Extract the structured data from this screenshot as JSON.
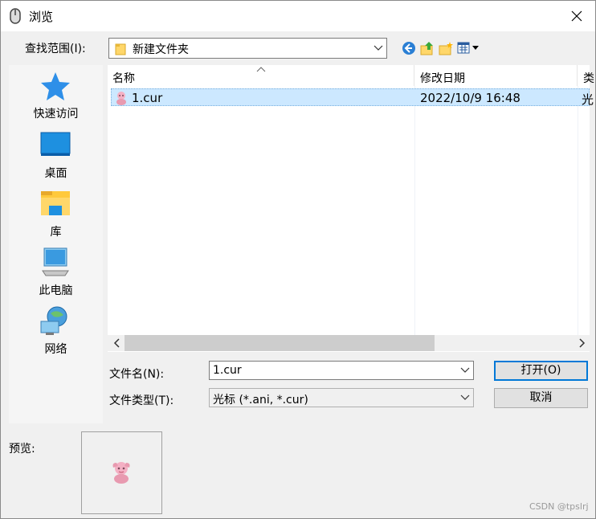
{
  "window": {
    "title": "浏览",
    "close_label": "✕"
  },
  "lookin": {
    "label": "查找范围(I):",
    "value": "新建文件夹"
  },
  "toolbar": {
    "icons": [
      "back-icon",
      "up-folder-icon",
      "new-folder-icon",
      "view-menu-icon"
    ]
  },
  "places": [
    {
      "label": "快速访问",
      "icon": "star-icon"
    },
    {
      "label": "桌面",
      "icon": "desktop-icon"
    },
    {
      "label": "库",
      "icon": "library-icon"
    },
    {
      "label": "此电脑",
      "icon": "computer-icon"
    },
    {
      "label": "网络",
      "icon": "network-icon"
    }
  ],
  "filelist": {
    "columns": {
      "name": "名称",
      "date": "修改日期",
      "type": "类"
    },
    "rows": [
      {
        "name": "1.cur",
        "date": "2022/10/9 16:48",
        "type": "光"
      }
    ]
  },
  "filename": {
    "label": "文件名(N):",
    "value": "1.cur"
  },
  "filetype": {
    "label": "文件类型(T):",
    "value": "光标 (*.ani, *.cur)"
  },
  "buttons": {
    "open": "打开(O)",
    "cancel": "取消"
  },
  "preview": {
    "label": "预览:"
  },
  "watermark": "CSDN @tpslrj",
  "colors": {
    "selection": "#cce8ff",
    "focus_border": "#0078d7",
    "folder": "#ffd76a",
    "desktop": "#1e90e0"
  }
}
